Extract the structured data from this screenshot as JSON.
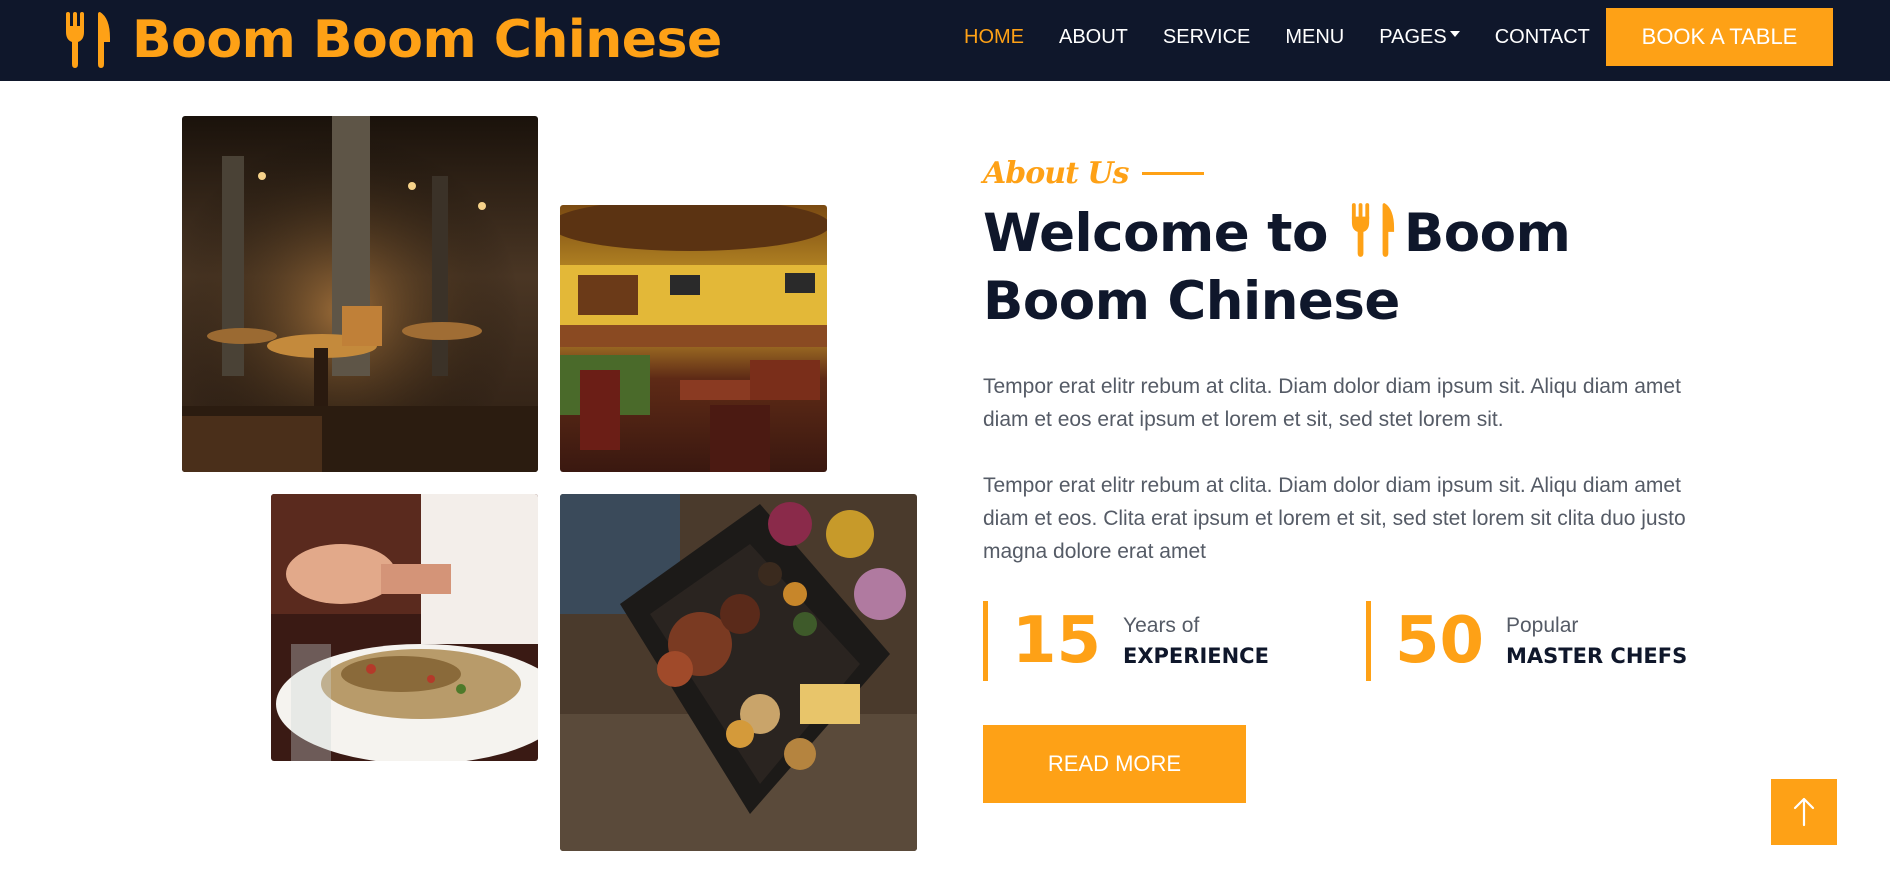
{
  "colors": {
    "primary": "#fea116",
    "dark": "#0f172b",
    "body_text": "#555b66",
    "white": "#ffffff"
  },
  "brand": {
    "icon": "utensils-icon",
    "name": "Boom Boom Chinese"
  },
  "nav": {
    "items": [
      {
        "label": "HOME",
        "active": true
      },
      {
        "label": "ABOUT",
        "active": false
      },
      {
        "label": "SERVICE",
        "active": false
      },
      {
        "label": "MENU",
        "active": false
      },
      {
        "label": "PAGES",
        "active": false,
        "dropdown": true
      },
      {
        "label": "CONTACT",
        "active": false
      }
    ],
    "cta_label": "BOOK A TABLE"
  },
  "gallery": {
    "images": [
      {
        "subject": "restaurant-interior-dark"
      },
      {
        "subject": "restaurant-bar-yellow"
      },
      {
        "subject": "salad-plate"
      },
      {
        "subject": "grilled-platter"
      }
    ]
  },
  "about": {
    "tag": "About Us",
    "heading_prefix": "Welcome to",
    "heading_icon": "utensils-icon",
    "heading_brand": "Boom Boom Chinese",
    "paragraphs": [
      "Tempor erat elitr rebum at clita. Diam dolor diam ipsum sit. Aliqu diam amet diam et eos erat ipsum et lorem et sit, sed stet lorem sit.",
      "Tempor erat elitr rebum at clita. Diam dolor diam ipsum sit. Aliqu diam amet diam et eos. Clita erat ipsum et lorem et sit, sed stet lorem sit clita duo justo magna dolore erat amet"
    ],
    "stats": [
      {
        "number": "15",
        "label_small": "Years of",
        "label_big": "EXPERIENCE"
      },
      {
        "number": "50",
        "label_small": "Popular",
        "label_big": "MASTER CHEFS"
      }
    ],
    "read_more_label": "READ MORE"
  },
  "back_to_top": {
    "icon": "arrow-up-icon"
  }
}
